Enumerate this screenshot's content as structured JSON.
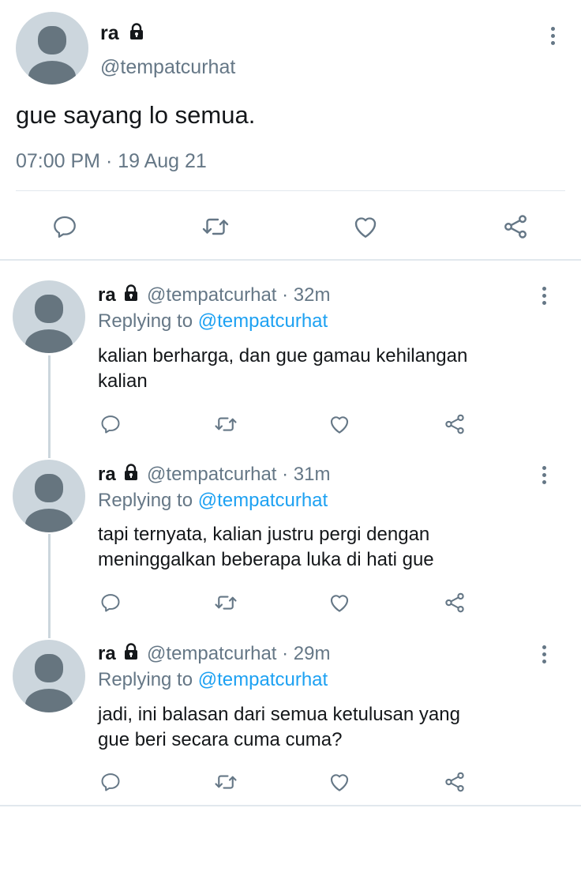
{
  "main_tweet": {
    "display_name": "ra",
    "handle": "@tempatcurhat",
    "text": "gue sayang lo semua.",
    "timestamp": "07:00 PM · 19 Aug 21",
    "icons": [
      "reply-icon",
      "retweet-icon",
      "like-icon",
      "share-icon"
    ]
  },
  "replies": [
    {
      "display_name": "ra",
      "handle": "@tempatcurhat",
      "time": "· 32m",
      "replying_prefix": "Replying to",
      "replying_handle": "@tempatcurhat",
      "text_line1": "kalian berharga, dan gue gamau kehilangan",
      "text_line2": "kalian"
    },
    {
      "display_name": "ra",
      "handle": "@tempatcurhat",
      "time": "· 31m",
      "replying_prefix": "Replying to",
      "replying_handle": "@tempatcurhat",
      "text_line1": "tapi ternyata, kalian justru pergi dengan",
      "text_line2": "meninggalkan beberapa luka di hati gue"
    },
    {
      "display_name": "ra",
      "handle": "@tempatcurhat",
      "time": "· 29m",
      "replying_prefix": "Replying to",
      "replying_handle": "@tempatcurhat",
      "text_line1": "jadi, ini balasan dari semua ketulusan yang",
      "text_line2": "gue beri secara cuma cuma?"
    }
  ],
  "colors": {
    "text": "#14171a",
    "muted": "#657786",
    "link": "#1da1f2",
    "divider": "#e1e8ed",
    "avatar_bg": "#ccd6dd",
    "avatar_fg": "#66757f"
  }
}
